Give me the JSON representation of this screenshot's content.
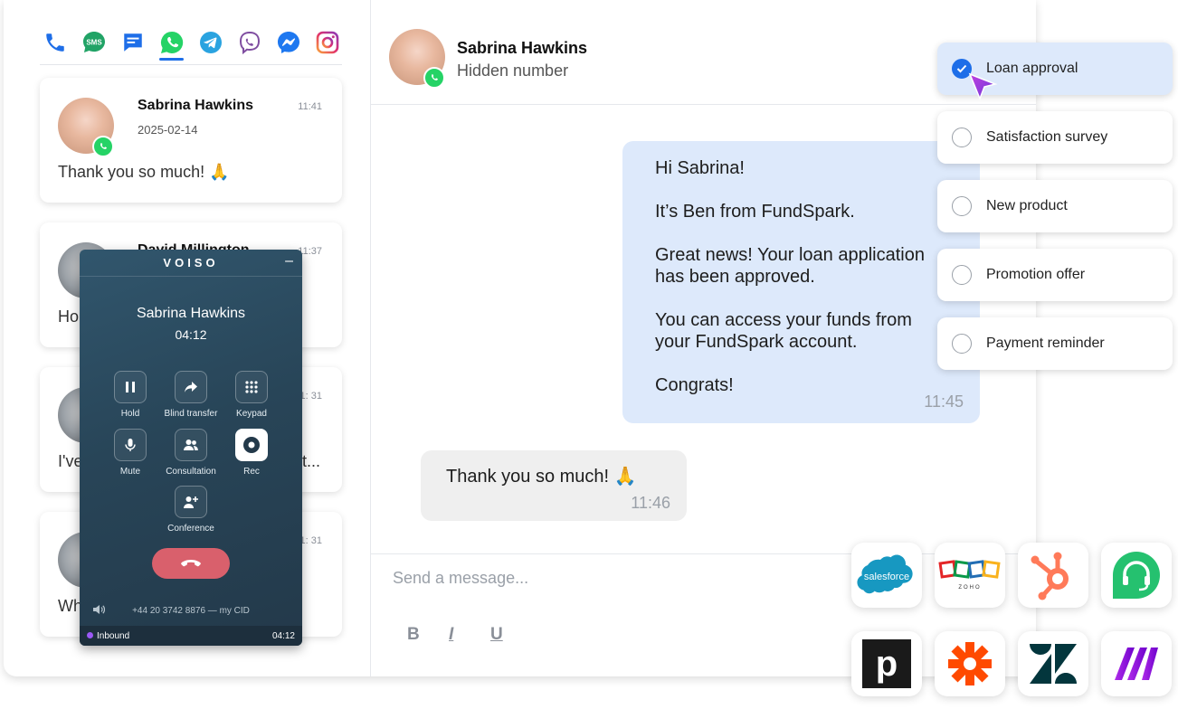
{
  "channels": [
    {
      "name": "phone-icon",
      "color": "#1e6ee8"
    },
    {
      "name": "sms-icon",
      "label": "SMS",
      "color": "#21a366"
    },
    {
      "name": "message-icon",
      "color": "#1e6ee8"
    },
    {
      "name": "whatsapp-icon",
      "color": "#25d366",
      "active": true
    },
    {
      "name": "telegram-icon",
      "color": "#2aa3e0"
    },
    {
      "name": "viber-icon",
      "color": "#7f4da0"
    },
    {
      "name": "messenger-icon",
      "color": "#1e78f0"
    },
    {
      "name": "instagram-icon",
      "color": "#d62976"
    }
  ],
  "conversations": [
    {
      "name": "Sabrina Hawkins",
      "date": "2025-02-14",
      "time": "11:41",
      "preview": "Thank you so much! 🙏"
    },
    {
      "name": "David Millington",
      "time": "11:37",
      "preview": "Ho"
    },
    {
      "time": "1: 31",
      "preview": "I've",
      "preview_tail": "t..."
    },
    {
      "time": "1: 31",
      "preview": "Wh"
    }
  ],
  "softphone": {
    "brand": "VOISO",
    "minimize": "–",
    "contact": "Sabrina Hawkins",
    "timer": "04:12",
    "buttons": [
      "Hold",
      "Blind transfer",
      "Keypad",
      "Mute",
      "Consultation",
      "Rec",
      "Conference"
    ],
    "caller_id": "+44 20 3742 8876 — my CID",
    "direction": "Inbound",
    "footer_timer": "04:12"
  },
  "chat": {
    "contact_name": "Sabrina Hawkins",
    "contact_sub": "Hidden number",
    "outgoing": {
      "lines": [
        "Hi Sabrina!",
        "It’s Ben from FundSpark.",
        "Great news! Your loan application has been approved.",
        "You can access your funds from your FundSpark account.",
        "Congrats!"
      ],
      "time": "11:45"
    },
    "incoming": {
      "text": "Thank you so much! 🙏",
      "time": "11:46"
    },
    "composer_placeholder": "Send a message...",
    "format": {
      "bold": "B",
      "italic": "I",
      "underline": "U"
    }
  },
  "templates": [
    {
      "label": "Loan approval",
      "selected": true
    },
    {
      "label": "Satisfaction survey",
      "selected": false
    },
    {
      "label": "New product",
      "selected": false
    },
    {
      "label": "Promotion offer",
      "selected": false
    },
    {
      "label": "Payment reminder",
      "selected": false
    }
  ],
  "integrations": [
    {
      "name": "salesforce-logo",
      "label": "salesforce",
      "color": "#1798c1"
    },
    {
      "name": "zoho-logo",
      "label": "ZOHO"
    },
    {
      "name": "hubspot-logo",
      "color": "#ff7a59"
    },
    {
      "name": "freshdesk-logo",
      "color": "#25c16f"
    },
    {
      "name": "pipedrive-logo",
      "label": "p",
      "color": "#1a1a1a"
    },
    {
      "name": "zapier-logo",
      "color": "#ff4a00"
    },
    {
      "name": "zendesk-logo",
      "color": "#03363d"
    },
    {
      "name": "make-logo",
      "color": "#6d00cc"
    }
  ]
}
